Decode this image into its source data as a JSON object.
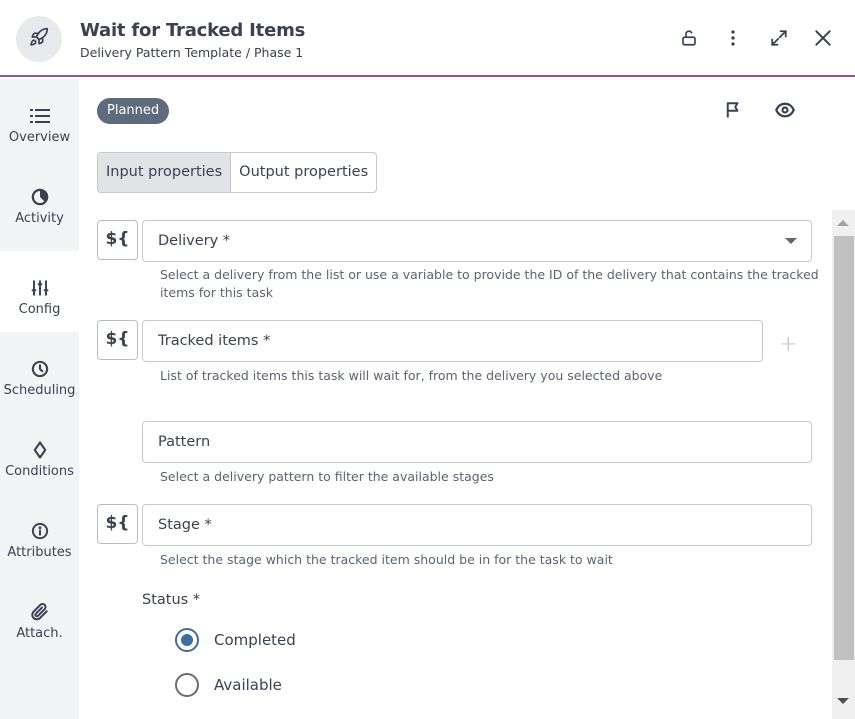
{
  "header": {
    "title": "Wait for Tracked Items",
    "breadcrumb": "Delivery Pattern Template / Phase 1",
    "icons": [
      "rocket-icon",
      "unlock-icon",
      "more-vertical-icon",
      "expand-icon",
      "close-icon"
    ]
  },
  "sidebar": {
    "items": [
      {
        "label": "Overview",
        "icon": "list-icon",
        "active": false
      },
      {
        "label": "Activity",
        "icon": "activity-pie-icon",
        "active": false
      },
      {
        "label": "Config",
        "icon": "sliders-icon",
        "active": true
      },
      {
        "label": "Scheduling",
        "icon": "clock-icon",
        "active": false
      },
      {
        "label": "Conditions",
        "icon": "diamond-icon",
        "active": false
      },
      {
        "label": "Attributes",
        "icon": "info-icon",
        "active": false
      },
      {
        "label": "Attach.",
        "icon": "paperclip-icon",
        "active": false
      }
    ]
  },
  "main": {
    "status_badge": "Planned",
    "top_icons": [
      "flag-icon",
      "eye-icon"
    ],
    "tabs": [
      {
        "label": "Input properties",
        "active": true
      },
      {
        "label": "Output properties",
        "active": false
      }
    ],
    "variable_button_label": "${",
    "fields": [
      {
        "label": "Delivery *",
        "type": "dropdown",
        "help": "Select a delivery from the list or use a variable to provide the ID of the delivery that contains the tracked items for this task"
      },
      {
        "label": "Tracked items *",
        "type": "list",
        "help": "List of tracked items this task will wait for, from the delivery you selected above",
        "add_label": "+"
      },
      {
        "label": "Pattern",
        "type": "text",
        "help": "Select a delivery pattern to filter the available stages"
      },
      {
        "label": "Stage *",
        "type": "text",
        "help": "Select the stage which the tracked item should be in for the task to wait"
      }
    ],
    "status": {
      "label": "Status *",
      "options": [
        {
          "label": "Completed",
          "selected": true
        },
        {
          "label": "Available",
          "selected": false
        }
      ]
    }
  },
  "colors": {
    "accent": "#7e57c2",
    "badge": "#5d6b7d",
    "radio_selected": "#3f6e9e",
    "text": "#3b4151"
  }
}
